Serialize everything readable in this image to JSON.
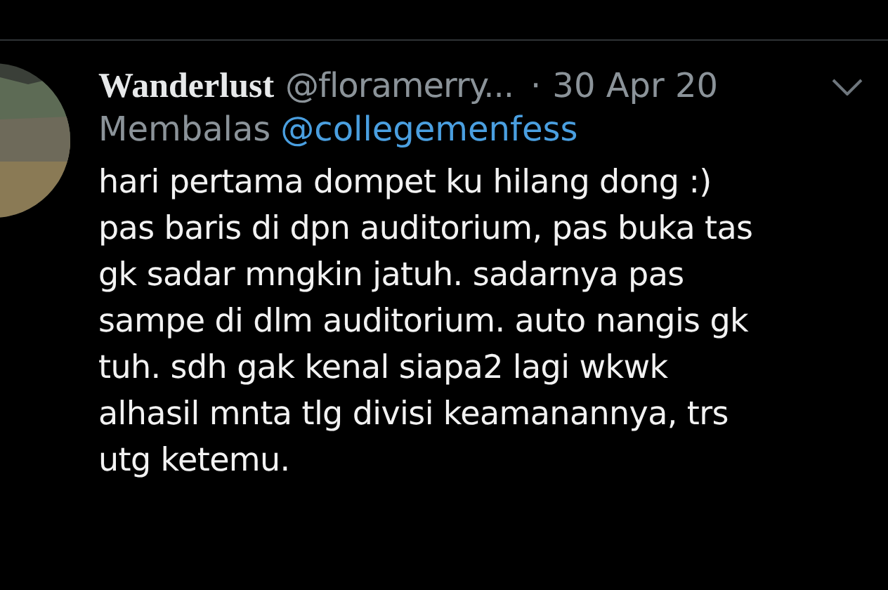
{
  "tweet": {
    "display_name": "Wanderlust",
    "handle": "@floramerry...",
    "separator": "·",
    "date": "30 Apr 20",
    "reply_label": "Membalas",
    "reply_to": "@collegemenfess",
    "body_lines": [
      "hari pertama dompet ku hilang dong :)",
      "pas baris di dpn auditorium, pas buka tas",
      "gk sadar mngkin jatuh. sadarnya pas",
      "sampe di dlm auditorium. auto nangis gk",
      "tuh. sdh gak kenal siapa2 lagi wkwk",
      "alhasil mnta tlg divisi keamanannya, trs",
      "utg ketemu."
    ]
  }
}
